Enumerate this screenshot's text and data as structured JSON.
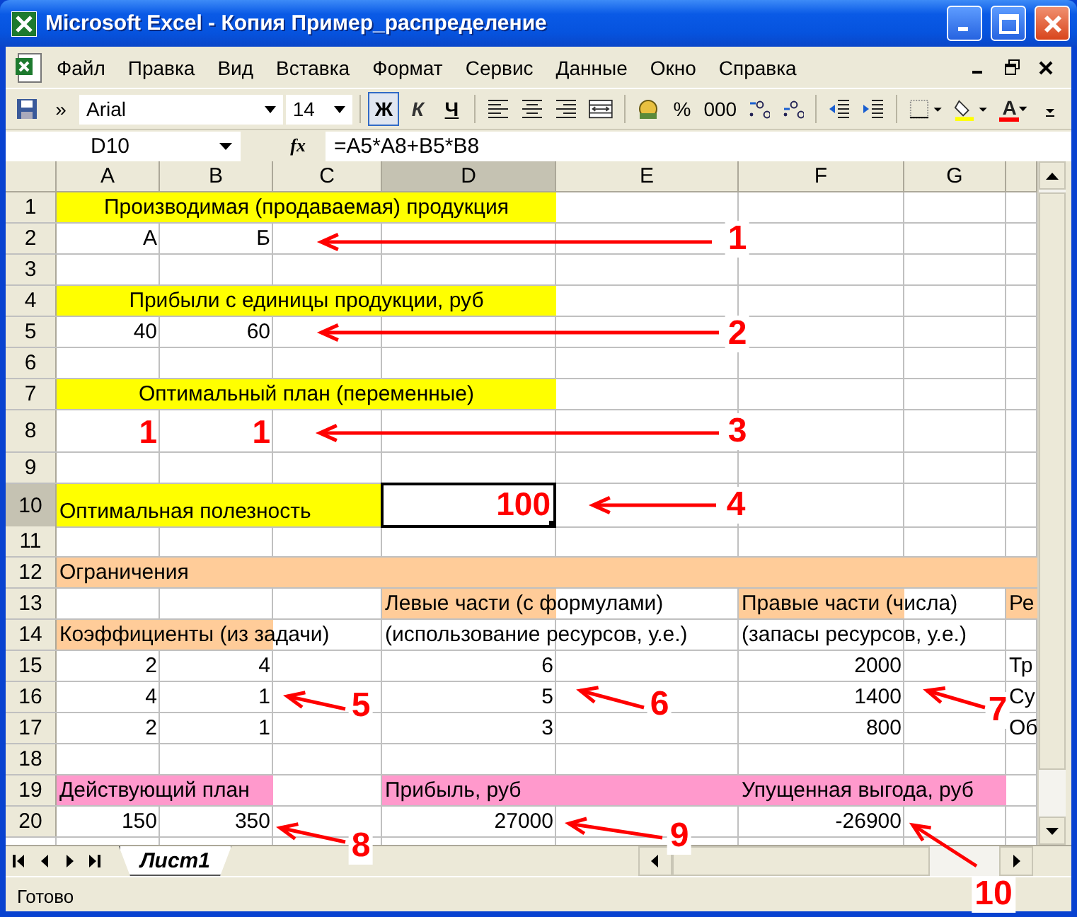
{
  "window": {
    "title": "Microsoft Excel - Копия Пример_распределение"
  },
  "menu": [
    {
      "label": "Файл"
    },
    {
      "label": "Правка"
    },
    {
      "label": "Вид"
    },
    {
      "label": "Вставка"
    },
    {
      "label": "Формат"
    },
    {
      "label": "Сервис"
    },
    {
      "label": "Данные"
    },
    {
      "label": "Окно"
    },
    {
      "label": "Справка"
    }
  ],
  "toolbar": [
    {
      "kind": "save"
    },
    {
      "kind": "text",
      "text": "»"
    },
    {
      "kind": "font",
      "value": "Arial"
    },
    {
      "kind": "size",
      "value": "14"
    },
    {
      "kind": "separator"
    },
    {
      "kind": "bold",
      "text": "Ж",
      "pressed": true
    },
    {
      "kind": "italic",
      "text": "К",
      "pressed": false
    },
    {
      "kind": "underline",
      "text": "Ч",
      "pressed": false
    },
    {
      "kind": "separator"
    },
    {
      "kind": "align-left"
    },
    {
      "kind": "align-center"
    },
    {
      "kind": "align-right"
    },
    {
      "kind": "merge"
    },
    {
      "kind": "separator"
    },
    {
      "kind": "currency"
    },
    {
      "kind": "text",
      "text": "%"
    },
    {
      "kind": "text",
      "text": "000"
    },
    {
      "kind": "decimal-more"
    },
    {
      "kind": "decimal-less"
    },
    {
      "kind": "separator"
    },
    {
      "kind": "outdent"
    },
    {
      "kind": "indent"
    },
    {
      "kind": "separator"
    },
    {
      "kind": "borders"
    },
    {
      "kind": "fill-color"
    },
    {
      "kind": "font-color",
      "text": "A"
    },
    {
      "kind": "options"
    }
  ],
  "formula_bar": {
    "name_box": "D10",
    "fx": "fx",
    "formula": "=A5*A8+B5*B8"
  },
  "sheet": {
    "columns": [
      {
        "label": "A",
        "selected": false
      },
      {
        "label": "B",
        "selected": false
      },
      {
        "label": "C",
        "selected": false
      },
      {
        "label": "D",
        "selected": true
      },
      {
        "label": "E",
        "selected": false
      },
      {
        "label": "F",
        "selected": false
      },
      {
        "label": "G",
        "selected": false
      },
      {
        "selected": false
      }
    ],
    "rows": [
      {
        "number": "1",
        "selected": false,
        "cells": [
          {
            "text": "Производимая (продаваемая) продукция",
            "kind": "title",
            "color": "#ffff00"
          },
          {
            "merged": true,
            "color": "#ffff00"
          },
          {
            "merged": true,
            "color": "#ffff00"
          },
          {
            "merged": true,
            "color": "#ffff00"
          },
          {},
          {},
          {},
          {}
        ]
      },
      {
        "number": "2",
        "selected": false,
        "cells": [
          {
            "text": "А",
            "kind": "value"
          },
          {
            "text": "Б",
            "kind": "value"
          },
          {},
          {},
          {},
          {},
          {},
          {}
        ]
      },
      {
        "number": "3",
        "selected": false,
        "cells": [
          {},
          {},
          {},
          {},
          {},
          {},
          {},
          {}
        ]
      },
      {
        "number": "4",
        "selected": false,
        "cells": [
          {
            "text": "Прибыли с единицы продукции, руб",
            "kind": "title",
            "color": "#ffff00"
          },
          {
            "merged": true,
            "color": "#ffff00"
          },
          {
            "merged": true,
            "color": "#ffff00"
          },
          {
            "merged": true,
            "color": "#ffff00"
          },
          {},
          {},
          {},
          {}
        ]
      },
      {
        "number": "5",
        "selected": false,
        "cells": [
          {
            "text": "40",
            "kind": "value"
          },
          {
            "text": "60",
            "kind": "value"
          },
          {},
          {},
          {},
          {},
          {},
          {}
        ]
      },
      {
        "number": "6",
        "selected": false,
        "cells": [
          {},
          {},
          {},
          {},
          {},
          {},
          {},
          {}
        ]
      },
      {
        "number": "7",
        "selected": false,
        "cells": [
          {
            "text": "Оптимальный план (переменные)",
            "kind": "title",
            "color": "#ffff00"
          },
          {
            "merged": true,
            "color": "#ffff00"
          },
          {
            "merged": true,
            "color": "#ffff00"
          },
          {
            "merged": true,
            "color": "#ffff00"
          },
          {},
          {},
          {},
          {}
        ]
      },
      {
        "number": "8",
        "selected": false,
        "cells": [
          {
            "text": "1",
            "kind": "value",
            "strong": true
          },
          {
            "text": "1",
            "kind": "value",
            "strong": true
          },
          {},
          {},
          {},
          {},
          {},
          {}
        ]
      },
      {
        "number": "9",
        "selected": false,
        "cells": [
          {},
          {},
          {},
          {},
          {},
          {},
          {},
          {}
        ]
      },
      {
        "number": "10",
        "selected": true,
        "cells": [
          {
            "text": "Оптимальная полезность",
            "kind": "label",
            "color": "#ffff00"
          },
          {
            "color": "#ffff00"
          },
          {
            "color": "#ffff00"
          },
          {
            "text": "100",
            "kind": "value",
            "strong": true
          },
          {},
          {},
          {},
          {}
        ]
      },
      {
        "number": "11",
        "selected": false,
        "cells": [
          {},
          {},
          {},
          {},
          {},
          {},
          {},
          {}
        ]
      },
      {
        "number": "12",
        "selected": false,
        "cells": [
          {
            "text": "Ограничения",
            "kind": "label",
            "color": "#ffcc99"
          },
          {
            "color": "#ffcc99"
          },
          {
            "color": "#ffcc99"
          },
          {
            "color": "#ffcc99"
          },
          {
            "color": "#ffcc99"
          },
          {
            "color": "#ffcc99"
          },
          {
            "color": "#ffcc99"
          },
          {
            "color": "#ffcc99"
          }
        ]
      },
      {
        "number": "13",
        "selected": false,
        "cells": [
          {},
          {},
          {},
          {
            "text": "Левые части (с формулами)",
            "kind": "label",
            "color": "#ffcc99"
          },
          {},
          {
            "text": "Правые части (числа)",
            "kind": "label",
            "color": "#ffcc99"
          },
          {},
          {
            "text": "Ре",
            "kind": "label",
            "color": "#ffcc99"
          }
        ]
      },
      {
        "number": "14",
        "selected": false,
        "cells": [
          {
            "text": "Коэффициенты (из задачи)",
            "kind": "label",
            "color": "#ffcc99"
          },
          {
            "color": "#ffcc99"
          },
          {},
          {
            "text": "(использование ресурсов, у.е.)",
            "kind": "label"
          },
          {},
          {
            "text": "(запасы ресурсов, у.е.)",
            "kind": "label"
          },
          {},
          {}
        ]
      },
      {
        "number": "15",
        "selected": false,
        "cells": [
          {
            "text": "2",
            "kind": "value"
          },
          {
            "text": "4",
            "kind": "value"
          },
          {},
          {
            "text": "6",
            "kind": "value"
          },
          {},
          {
            "text": "2000",
            "kind": "value"
          },
          {},
          {
            "text": "Тр",
            "kind": "label"
          }
        ]
      },
      {
        "number": "16",
        "selected": false,
        "cells": [
          {
            "text": "4",
            "kind": "value"
          },
          {
            "text": "1",
            "kind": "value"
          },
          {},
          {
            "text": "5",
            "kind": "value"
          },
          {},
          {
            "text": "1400",
            "kind": "value"
          },
          {},
          {
            "text": "Су",
            "kind": "label"
          }
        ]
      },
      {
        "number": "17",
        "selected": false,
        "cells": [
          {
            "text": "2",
            "kind": "value"
          },
          {
            "text": "1",
            "kind": "value"
          },
          {},
          {
            "text": "3",
            "kind": "value"
          },
          {},
          {
            "text": "800",
            "kind": "value"
          },
          {},
          {
            "text": "Об",
            "kind": "label"
          }
        ]
      },
      {
        "number": "18",
        "selected": false,
        "cells": [
          {},
          {},
          {},
          {},
          {},
          {},
          {},
          {}
        ]
      },
      {
        "number": "19",
        "selected": false,
        "cells": [
          {
            "text": "Действующий план",
            "kind": "label",
            "color": "#ff99cc"
          },
          {
            "color": "#ff99cc"
          },
          {},
          {
            "text": "Прибыль, руб",
            "kind": "label",
            "color": "#ff99cc"
          },
          {
            "color": "#ff99cc"
          },
          {
            "text": "Упущенная выгода, руб",
            "kind": "label",
            "color": "#ff99cc"
          },
          {
            "color": "#ff99cc"
          },
          {}
        ]
      },
      {
        "number": "20",
        "selected": false,
        "cells": [
          {
            "text": "150",
            "kind": "value"
          },
          {
            "text": "350",
            "kind": "value"
          },
          {},
          {
            "text": "27000",
            "kind": "value"
          },
          {},
          {
            "text": "-26900",
            "kind": "value"
          },
          {},
          {}
        ]
      }
    ]
  },
  "sheet_tabs": [
    {
      "label": "Лист1",
      "selected": true
    }
  ],
  "status_bar": {
    "text": "Готово"
  },
  "callouts": [
    {
      "label": "1"
    },
    {
      "label": "2"
    },
    {
      "label": "3"
    },
    {
      "label": "4"
    },
    {
      "label": "5"
    },
    {
      "label": "6"
    },
    {
      "label": "7"
    },
    {
      "label": "8"
    },
    {
      "label": "9"
    },
    {
      "label": "10"
    }
  ]
}
